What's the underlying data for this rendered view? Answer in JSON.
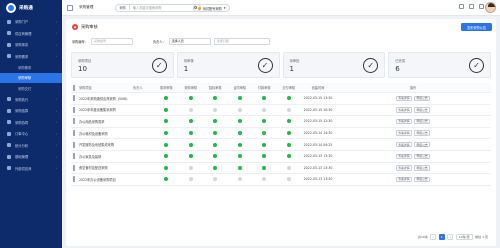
{
  "app": {
    "name": "采购通"
  },
  "sidebar": {
    "items": [
      {
        "label": "采购门户",
        "type": "main"
      },
      {
        "label": "供应商管理",
        "type": "main"
      },
      {
        "label": "采购事务",
        "type": "main"
      },
      {
        "label": "采购需求",
        "type": "main"
      },
      {
        "label": "采购需求",
        "type": "sub"
      },
      {
        "label": "采购审核",
        "type": "sub",
        "active": true
      },
      {
        "label": "采购交付",
        "type": "sub"
      },
      {
        "label": "采购执行",
        "type": "main"
      },
      {
        "label": "采购结算",
        "type": "main"
      },
      {
        "label": "采购协同",
        "type": "main"
      },
      {
        "label": "订单中心",
        "type": "main"
      },
      {
        "label": "统计分析",
        "type": "main"
      },
      {
        "label": "基础管理",
        "type": "main"
      },
      {
        "label": "外部供应商",
        "type": "main"
      }
    ]
  },
  "topbar": {
    "breadcrumb": "采购管理",
    "search": {
      "select": "采购",
      "placeholder": "输入关键字搜索采购"
    },
    "tenant": "测试账号采购"
  },
  "panel": {
    "title": "采购审核",
    "new_button": "发布采购公告",
    "filters": {
      "code_label": "采购编号：",
      "code_placeholder": "采购编号",
      "owner_label": "负责人：",
      "owner_value": "选择人员",
      "date_placeholder": "选择日期"
    },
    "cards": [
      {
        "label": "采购项目",
        "value": "10"
      },
      {
        "label": "待审核",
        "value": "1"
      },
      {
        "label": "待审批",
        "value": "1"
      },
      {
        "label": "已完成",
        "value": "6"
      }
    ]
  },
  "table": {
    "columns": [
      "采购项目",
      "负责人",
      "需求审核",
      "采购审核",
      "招标审核",
      "合同审核",
      "付款审核",
      "交付审核",
      "创建时间",
      "操作"
    ],
    "rows": [
      {
        "name": "2022年采购通供应商采购（50W）",
        "owner": "",
        "status": [
          1,
          1,
          1,
          1,
          1,
          1
        ],
        "date": "2022-03-15 13:30",
        "actions": [
          "查看详情",
          "申报公告"
        ]
      },
      {
        "name": "2022年年度设备集采采购",
        "owner": "",
        "status": [
          1,
          0,
          0,
          0,
          0,
          0
        ],
        "date": "2022-03-15 10:30",
        "actions": [
          "查看详情",
          "申报公告"
        ]
      },
      {
        "name": "办公用品采购需求",
        "owner": "",
        "status": [
          1,
          1,
          1,
          1,
          1,
          1
        ],
        "date": "2022-03-15 12:30",
        "actions": [
          "查看详情",
          "申报公告"
        ]
      },
      {
        "name": "办公耗材及设备采购",
        "owner": "",
        "status": [
          1,
          1,
          1,
          1,
          1,
          1
        ],
        "date": "2022-03-14 14:30",
        "actions": [
          "查看详情",
          "申报公告"
        ]
      },
      {
        "name": "开发服务及系统集成采购",
        "owner": "",
        "status": [
          1,
          1,
          1,
          1,
          1,
          1
        ],
        "date": "2022-03-14 09:25",
        "actions": [
          "查看详情",
          "申报公告"
        ]
      },
      {
        "name": "办公家具及装修",
        "owner": "",
        "status": [
          1,
          1,
          1,
          1,
          1,
          1
        ],
        "date": "2022-03-13 13:30",
        "actions": [
          "查看详情",
          "申报公告"
        ]
      },
      {
        "name": "食堂食材及配送采购",
        "owner": "",
        "status": [
          1,
          0,
          1,
          1,
          1,
          0
        ],
        "date": "2022-03-13 13:30",
        "actions": [
          "查看详情",
          "申报公告"
        ]
      },
      {
        "name": "2022年办公设备采购项目",
        "owner": "",
        "status": [
          1,
          0,
          0,
          0,
          0,
          0
        ],
        "date": "2022-03-13 13:30",
        "actions": [
          "查看详情",
          "申报公告"
        ]
      }
    ]
  },
  "pager": {
    "total": "共10条",
    "page": "1",
    "page_size": "10条/页",
    "goto": "前往 1 页"
  },
  "colors": {
    "sidebar": "#0d2a6b",
    "accent": "#2b74e8",
    "ok": "#1fb84c",
    "pending": "#d3d7de"
  }
}
